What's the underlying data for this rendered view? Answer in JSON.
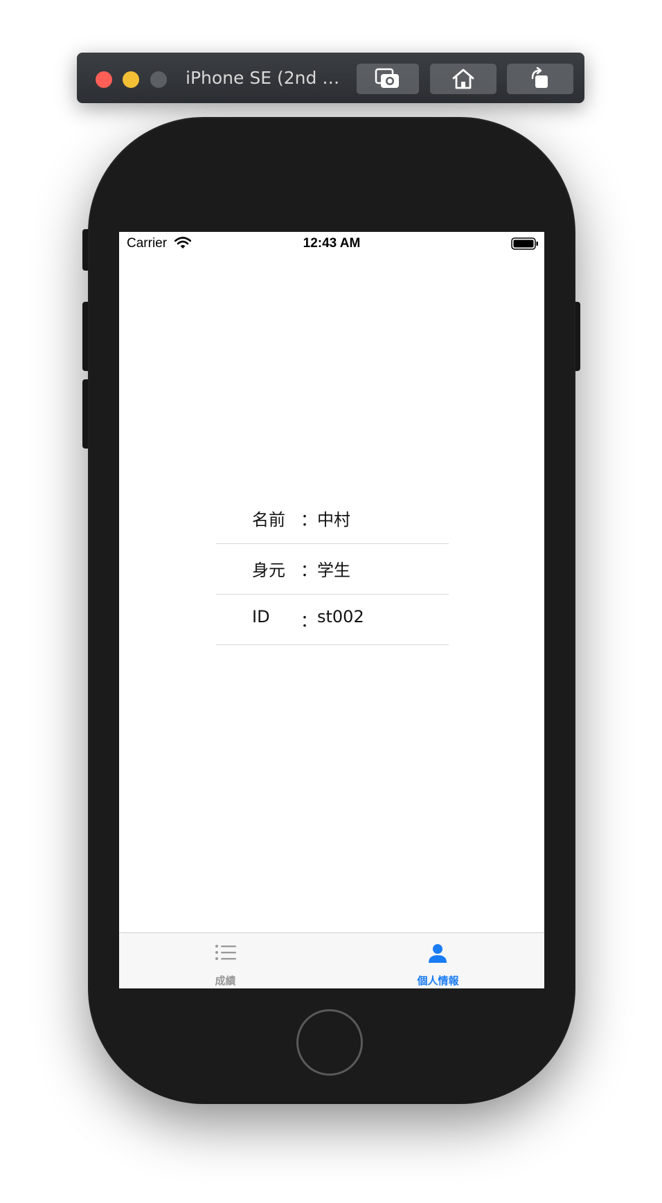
{
  "simulator": {
    "window_title": "iPhone SE (2nd g...",
    "buttons": {
      "screenshot": "camera-icon",
      "home": "home-icon",
      "rotate": "rotate-icon"
    }
  },
  "status_bar": {
    "carrier": "Carrier",
    "time": "12:43 AM"
  },
  "profile": {
    "rows": [
      {
        "label": "名前",
        "separator": "：",
        "value": "中村"
      },
      {
        "label": "身元",
        "separator": "：",
        "value": "学生"
      },
      {
        "label": "ID",
        "separator": "：",
        "value": "st002"
      }
    ]
  },
  "tab_bar": {
    "tabs": [
      {
        "label": "成績",
        "icon": "list-icon",
        "selected": false
      },
      {
        "label": "個人情報",
        "icon": "person-icon",
        "selected": true
      }
    ]
  },
  "colors": {
    "accent": "#1a7cf5",
    "inactive_tab": "#9a9a9a"
  }
}
